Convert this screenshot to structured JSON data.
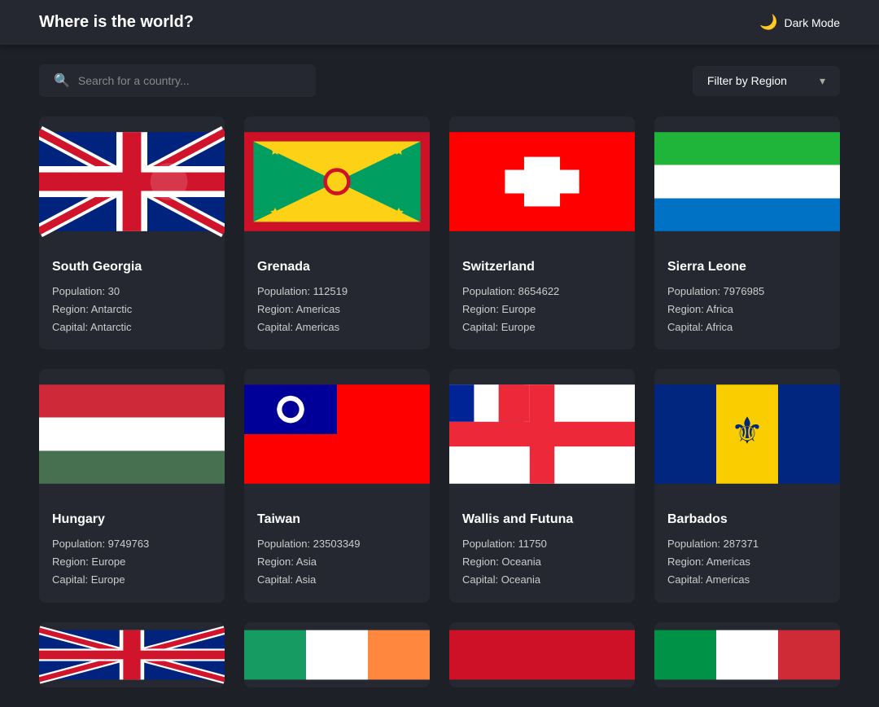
{
  "header": {
    "title": "Where is the world?",
    "dark_mode_label": "Dark Mode"
  },
  "controls": {
    "search_placeholder": "Search for a country...",
    "filter_label": "Filter by Region"
  },
  "countries": [
    {
      "name": "South Georgia",
      "population": "Population: 30",
      "region": "Region: Antarctic",
      "capital": "Capital: Antarctic",
      "flag_type": "south_georgia"
    },
    {
      "name": "Grenada",
      "population": "Population: 112519",
      "region": "Region: Americas",
      "capital": "Capital: Americas",
      "flag_type": "grenada"
    },
    {
      "name": "Switzerland",
      "population": "Population: 8654622",
      "region": "Region: Europe",
      "capital": "Capital: Europe",
      "flag_type": "switzerland"
    },
    {
      "name": "Sierra Leone",
      "population": "Population: 7976985",
      "region": "Region: Africa",
      "capital": "Capital: Africa",
      "flag_type": "sierra_leone"
    },
    {
      "name": "Hungary",
      "population": "Population: 9749763",
      "region": "Region: Europe",
      "capital": "Capital: Europe",
      "flag_type": "hungary"
    },
    {
      "name": "Taiwan",
      "population": "Population: 23503349",
      "region": "Region: Asia",
      "capital": "Capital: Asia",
      "flag_type": "taiwan"
    },
    {
      "name": "Wallis and Futuna",
      "population": "Population: 11750",
      "region": "Region: Oceania",
      "capital": "Capital: Oceania",
      "flag_type": "wallis_futuna"
    },
    {
      "name": "Barbados",
      "population": "Population: 287371",
      "region": "Region: Americas",
      "capital": "Capital: Americas",
      "flag_type": "barbados"
    }
  ],
  "partial_flags": [
    "uk_partial",
    "ireland_partial",
    "red_partial",
    "italy_partial"
  ]
}
